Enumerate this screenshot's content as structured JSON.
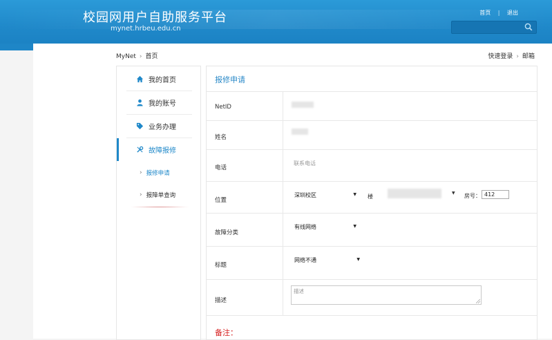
{
  "header": {
    "site_title": "校园网用户自助服务平台",
    "site_url": "mynet.hrbeu.edu.cn",
    "links": [
      "首页",
      "退出"
    ],
    "search_placeholder": ""
  },
  "breadcrumb": {
    "root": "MyNet",
    "current": "首页",
    "right_a": "快速登录",
    "right_b": "邮箱"
  },
  "sidebar": {
    "items": [
      {
        "label": "我的首页",
        "icon": "home-icon"
      },
      {
        "label": "我的账号",
        "icon": "user-icon"
      },
      {
        "label": "业务办理",
        "icon": "tag-icon"
      },
      {
        "label": "故障报修",
        "icon": "wrench-icon"
      }
    ],
    "subitems": [
      {
        "label": "报修申请",
        "active": true
      },
      {
        "label": "报障单查询",
        "active": false
      }
    ]
  },
  "form": {
    "title": "报修申请",
    "labels": {
      "netid": "NetID",
      "name": "姓名",
      "phone": "电话",
      "location": "位置",
      "category": "故障分类",
      "subject": "标题",
      "description": "描述"
    },
    "phone_placeholder": "联系电话",
    "campus_value": "深圳校区",
    "building_label": "楼",
    "room_label": "房号：",
    "room_value": "412",
    "category_value": "有线网络",
    "subject_value": "网络不通",
    "description_placeholder": "描述",
    "note_title": "备注："
  },
  "colors": {
    "header_blue": "#1f88c9",
    "accent": "#2b8ac8",
    "note_red": "#d62020"
  }
}
